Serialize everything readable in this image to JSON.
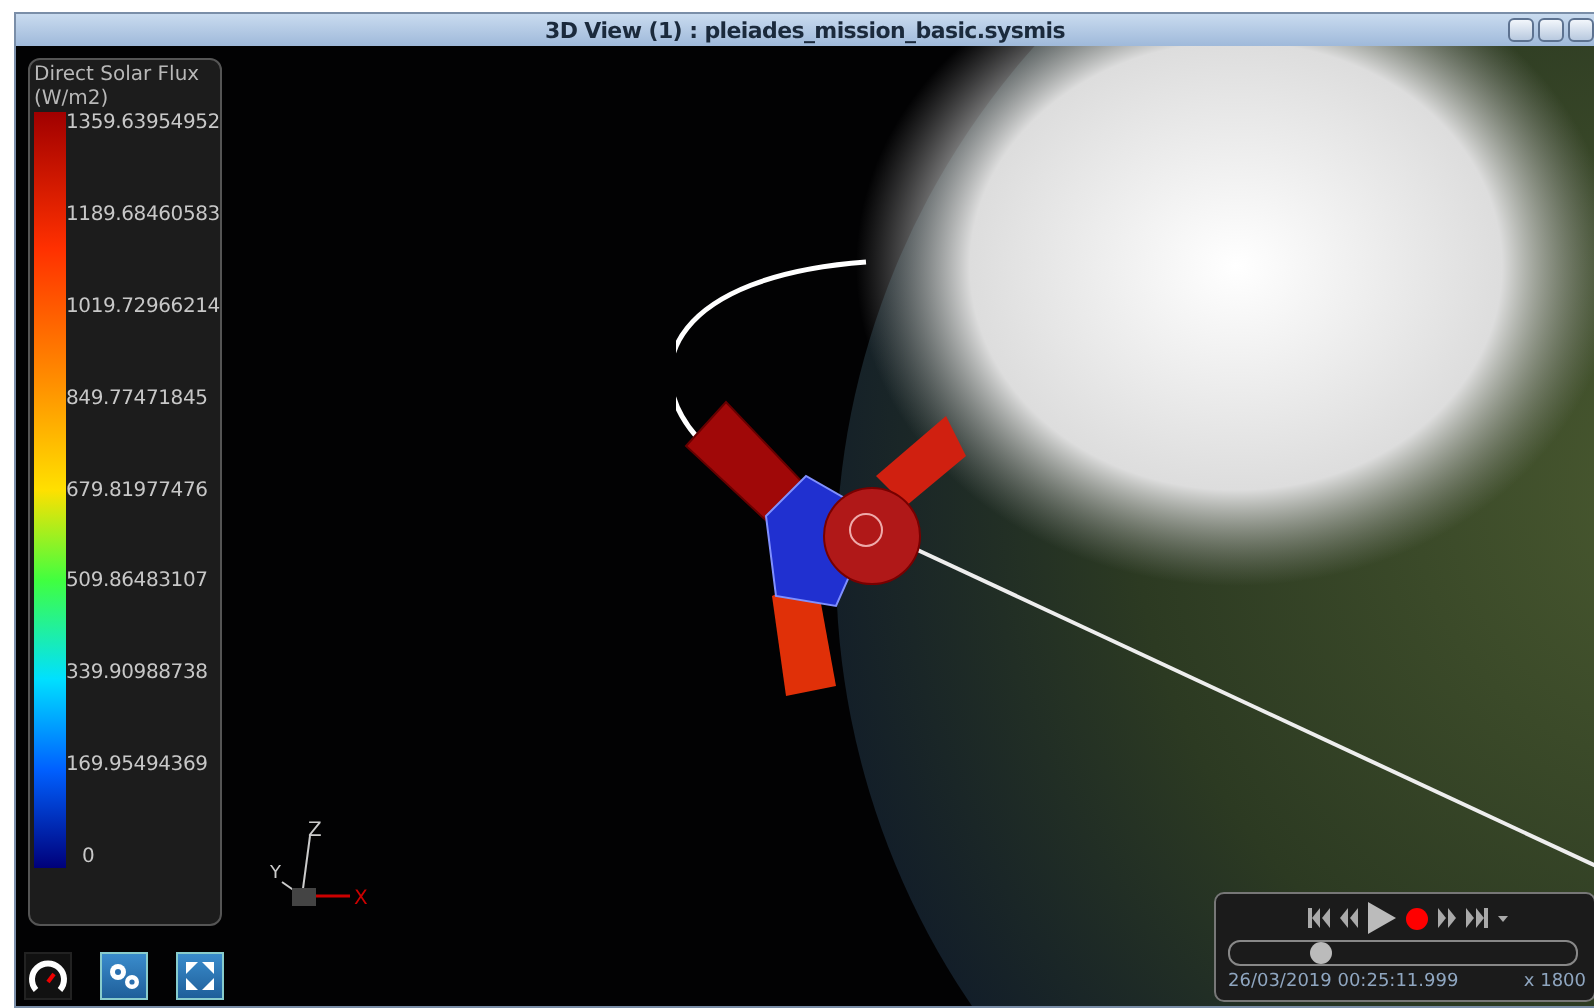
{
  "window": {
    "title": "3D View (1) : pleiades_mission_basic.sysmis"
  },
  "legend": {
    "title": "Direct Solar Flux (W/m2)",
    "ticks": [
      "1359.63954952",
      "1189.68460583",
      "1019.72966214",
      "849.77471845",
      "679.81977476",
      "509.86483107",
      "339.90988738",
      "169.95494369",
      "0"
    ]
  },
  "axes": {
    "x": "X",
    "y": "Y",
    "z": "Z"
  },
  "playback": {
    "recording": true,
    "date": "26/03/2019 00:25:11.999",
    "speed": "x 1800",
    "timeline": {
      "level": 0.26
    }
  }
}
